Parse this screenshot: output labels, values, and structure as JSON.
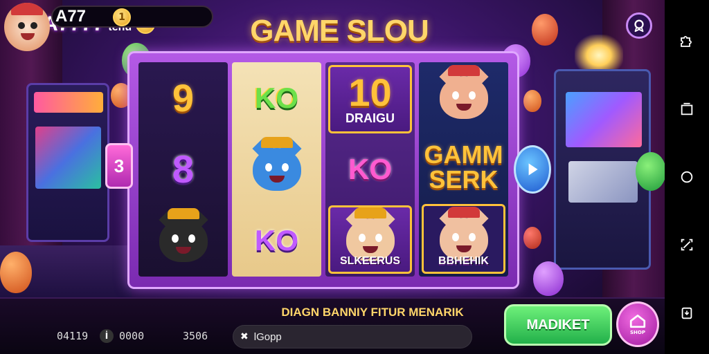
{
  "header": {
    "brand": "A7777",
    "brand_sub": "tehu",
    "title": "GAME SLOU"
  },
  "reels": [
    [
      {
        "kind": "text",
        "text": "9",
        "style": "sym-gold big"
      },
      {
        "kind": "text",
        "text": "8",
        "style": "sym-purple big"
      },
      {
        "kind": "animal",
        "color": "#2a2a2a",
        "hat": "gold",
        "caption": ""
      }
    ],
    [
      {
        "kind": "text",
        "text": "KO",
        "style": "sym-green mid"
      },
      {
        "kind": "animal",
        "color": "#3a8ae0",
        "hat": "gold",
        "caption": ""
      },
      {
        "kind": "text",
        "text": "KO",
        "style": "sym-purple mid"
      }
    ],
    [
      {
        "kind": "boxed",
        "text": "10",
        "sub": "DRAIGU"
      },
      {
        "kind": "text",
        "text": "KO",
        "style": "sym-pink mid"
      },
      {
        "kind": "animal",
        "color": "#f0c8a0",
        "hat": "gold",
        "caption": "SLKEERUS"
      }
    ],
    [
      {
        "kind": "animal",
        "color": "#f0b090",
        "hat": "red",
        "caption": ""
      },
      {
        "kind": "text2",
        "line1": "GAMM",
        "line2": "SERK"
      },
      {
        "kind": "animal",
        "color": "#f0c0a0",
        "hat": "red",
        "caption": "BBHEHIK"
      }
    ]
  ],
  "side": {
    "left_label": "3"
  },
  "player": {
    "name": "A77",
    "coin_digit": "1",
    "stat1": "04119",
    "stat2_icon": "İ",
    "stat2": "0000",
    "stat3": "3506"
  },
  "ticker": "DIAGN BANNIY FITUR MENARIK",
  "input": {
    "x": "✖",
    "text": "lGopp"
  },
  "market_label": "MADIKET",
  "shop_label": "SHOP",
  "colors": {
    "accent": "#b45ae6",
    "gold": "#ffc23a",
    "green": "#22b04a"
  }
}
